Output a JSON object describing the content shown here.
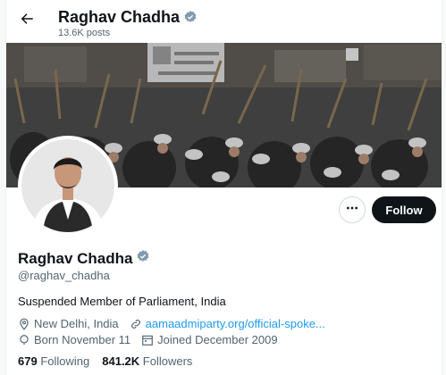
{
  "header": {
    "name": "Raghav Chadha",
    "posts": "13.6K posts"
  },
  "profile": {
    "name": "Raghav Chadha",
    "handle": "@raghav_chadha",
    "bio": "Suspended Member of Parliament, India",
    "location": "New Delhi, India",
    "website": "aamaadmiparty.org/official-spoke...",
    "born": "Born November 11",
    "joined": "Joined December 2009",
    "following_count": "679",
    "following_label": "Following",
    "followers_count": "841.2K",
    "followers_label": "Followers"
  },
  "actions": {
    "follow_label": "Follow",
    "more_icon": "more-horizontal-icon"
  },
  "icons": {
    "back": "arrow-left-icon",
    "verified": "verified-badge-icon",
    "location": "location-pin-icon",
    "link": "link-icon",
    "birthday": "balloon-icon",
    "calendar": "calendar-icon"
  },
  "colors": {
    "accent": "#1d9bf0",
    "text": "#0f1419",
    "secondary": "#536471",
    "follow_bg": "#0f1419"
  }
}
